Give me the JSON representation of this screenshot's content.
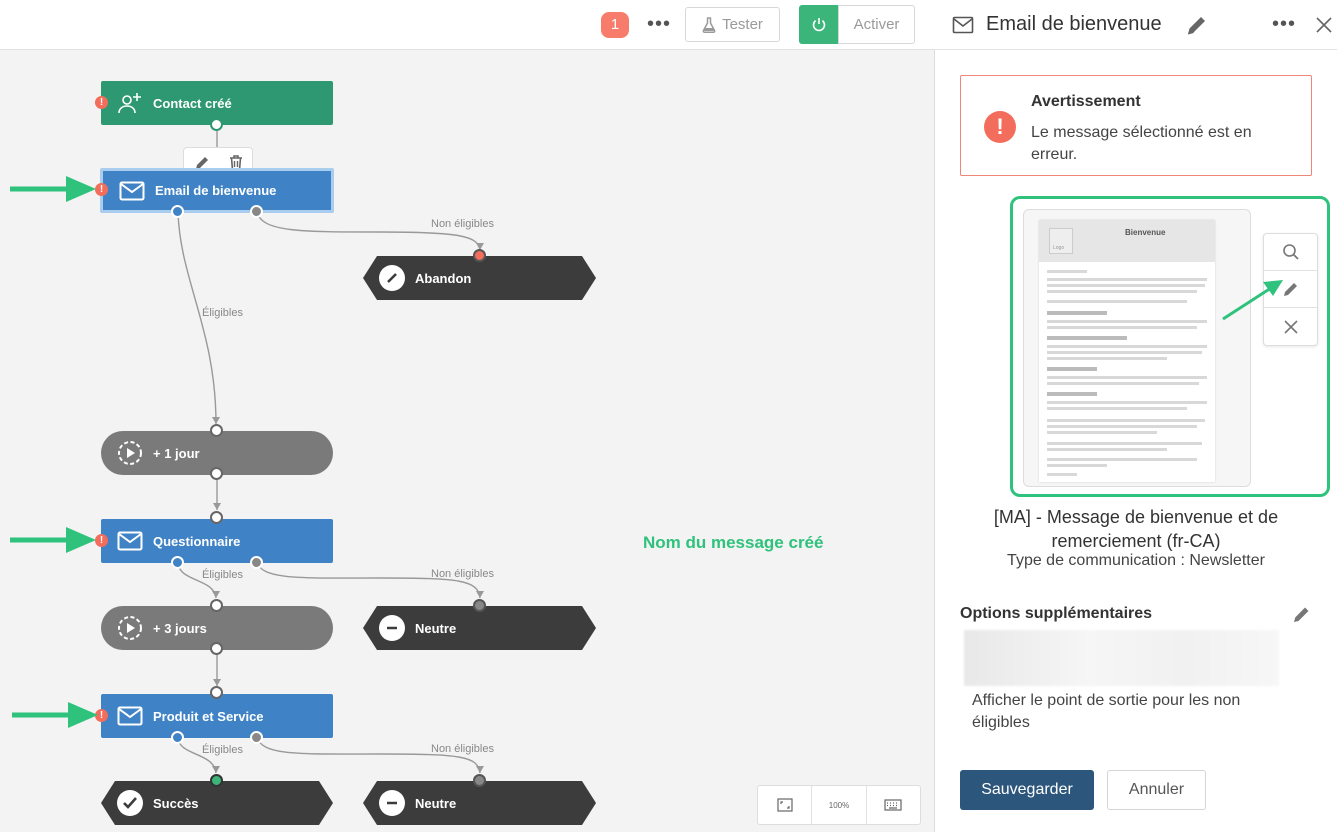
{
  "toolbar": {
    "badge_count": "1",
    "more_glyph": "•••",
    "test_label": "Tester",
    "activate_label": "Activer"
  },
  "workflow": {
    "nodes": {
      "contact_created": "Contact créé",
      "welcome_email": "Email de bienvenue",
      "abandon": "Abandon",
      "wait_1": "+ 1 jour",
      "survey": "Questionnaire",
      "neutral_1": "Neutre",
      "wait_3": "+ 3 jours",
      "product_service": "Produit et Service",
      "success": "Succès",
      "neutral_2": "Neutre"
    },
    "edge_labels": {
      "not_eligible": "Non éligibles",
      "eligible": "Éligibles"
    },
    "error_glyph": "!",
    "annotation": "Nom du message créé"
  },
  "zoom": {
    "level": "100%"
  },
  "panel": {
    "title": "Email de bienvenue",
    "more_glyph": "•••",
    "alert": {
      "icon": "!",
      "title": "Avertissement",
      "message": "Le message sélectionné est en erreur."
    },
    "preview": {
      "doc_title": "Bienvenue",
      "logo_text": "Logo"
    },
    "message_name": "[MA] - Message de bienvenue et de remerciement (fr-CA)",
    "communication_type": "Type de communication : Newsletter",
    "options_title": "Options supplémentaires",
    "options_text": "Afficher le point de sortie pour les non éligibles",
    "save_label": "Sauvegarder",
    "cancel_label": "Annuler"
  },
  "colors": {
    "node_trigger": "#2e9872",
    "node_email": "#3f83c6",
    "node_wait": "#7a7a7a",
    "node_exit": "#3c3c3c",
    "error": "#f26d5b",
    "annotation_green": "#2fc27c",
    "primary_button": "#2c567c"
  }
}
